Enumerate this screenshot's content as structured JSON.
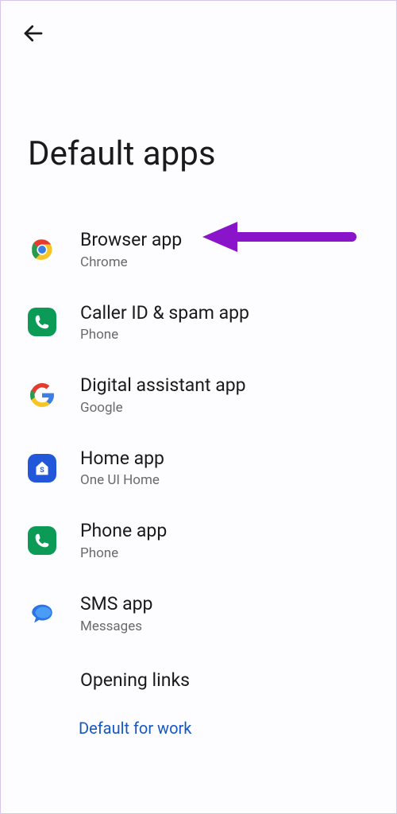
{
  "header": {
    "page_title": "Default apps"
  },
  "rows": [
    {
      "title": "Browser app",
      "subtitle": "Chrome",
      "icon": "chrome-icon"
    },
    {
      "title": "Caller ID & spam app",
      "subtitle": "Phone",
      "icon": "phone-app-icon"
    },
    {
      "title": "Digital assistant app",
      "subtitle": "Google",
      "icon": "google-icon"
    },
    {
      "title": "Home app",
      "subtitle": "One UI Home",
      "icon": "one-ui-home-icon"
    },
    {
      "title": "Phone app",
      "subtitle": "Phone",
      "icon": "phone-app-icon"
    },
    {
      "title": "SMS app",
      "subtitle": "Messages",
      "icon": "messages-icon"
    }
  ],
  "last_row": {
    "title": "Opening links"
  },
  "footer_link": "Default for work",
  "annotation": {
    "target": "Browser app",
    "color": "#8a14c9"
  }
}
